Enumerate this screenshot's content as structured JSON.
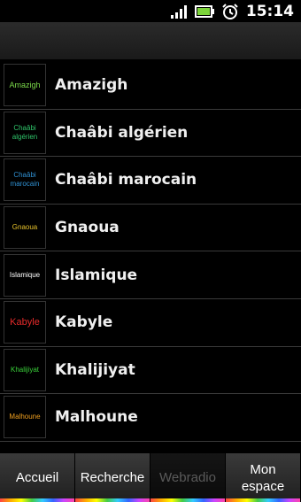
{
  "status_bar": {
    "time": "15:14",
    "icons": [
      "signal-icon",
      "battery-icon",
      "alarm-icon"
    ]
  },
  "genres": [
    {
      "thumb_text": "Amazigh",
      "name": "Amazigh",
      "thumb_color": "#7bd94a"
    },
    {
      "thumb_text": "Chaâbi\nalgérien",
      "name": "Chaâbi algérien",
      "thumb_color": "#2fc46a"
    },
    {
      "thumb_text": "Chaâbi\nmarocain",
      "name": "Chaâbi marocain",
      "thumb_color": "#2f8fd0"
    },
    {
      "thumb_text": "Gnaoua",
      "name": "Gnaoua",
      "thumb_color": "#e6c12a"
    },
    {
      "thumb_text": "Islamique",
      "name": "Islamique",
      "thumb_color": "#ffffff"
    },
    {
      "thumb_text": "Kabyle",
      "name": "Kabyle",
      "thumb_color": "#e52a2a"
    },
    {
      "thumb_text": "Khalijiyat",
      "name": "Khalijiyat",
      "thumb_color": "#3ad23a"
    },
    {
      "thumb_text": "Malhoune",
      "name": "Malhoune",
      "thumb_color": "#f0a020"
    }
  ],
  "bottom_nav": {
    "tabs": [
      {
        "label": "Accueil"
      },
      {
        "label": "Recherche"
      },
      {
        "label": "Webradio"
      },
      {
        "label": "Mon\nespace"
      }
    ]
  }
}
